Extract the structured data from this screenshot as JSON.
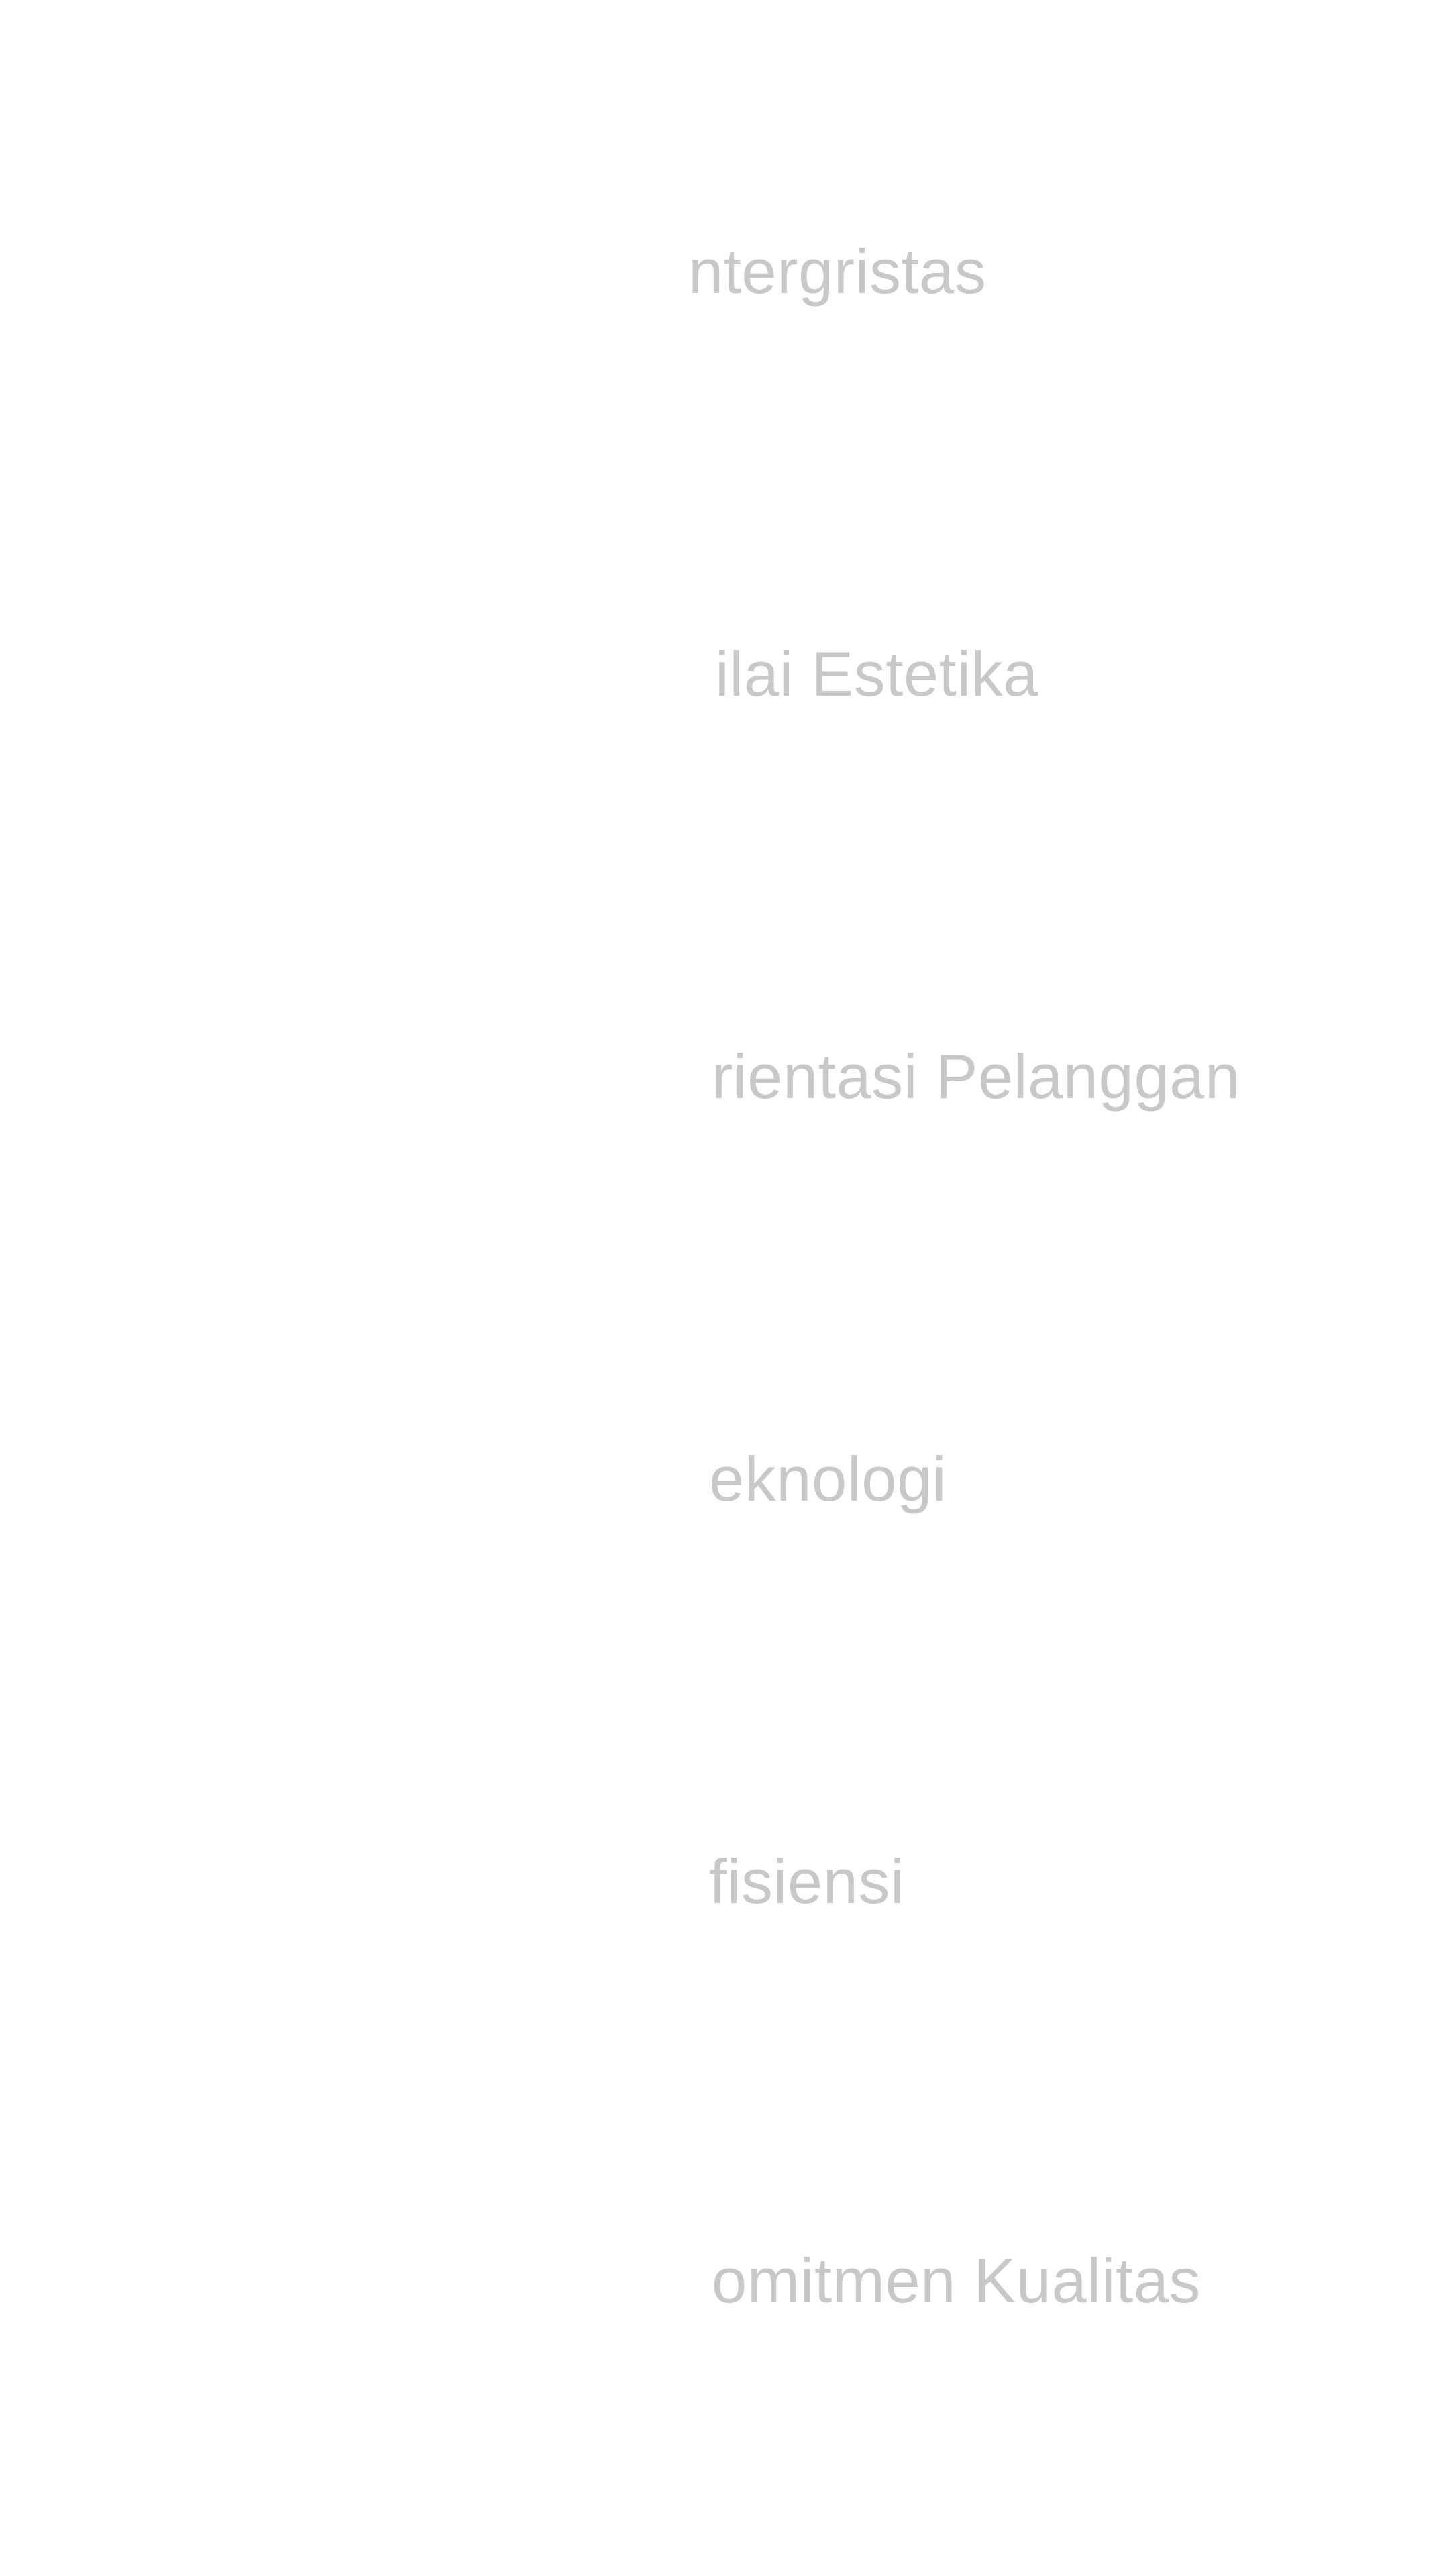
{
  "values": {
    "items": [
      {
        "label": "ntergristas"
      },
      {
        "label": "ilai Estetika"
      },
      {
        "label": "rientasi Pelanggan"
      },
      {
        "label": "eknologi"
      },
      {
        "label": "fisiensi"
      },
      {
        "label": "omitmen Kualitas"
      }
    ]
  },
  "colors": {
    "background": "#ffffff",
    "text": "#c8c8c8"
  }
}
